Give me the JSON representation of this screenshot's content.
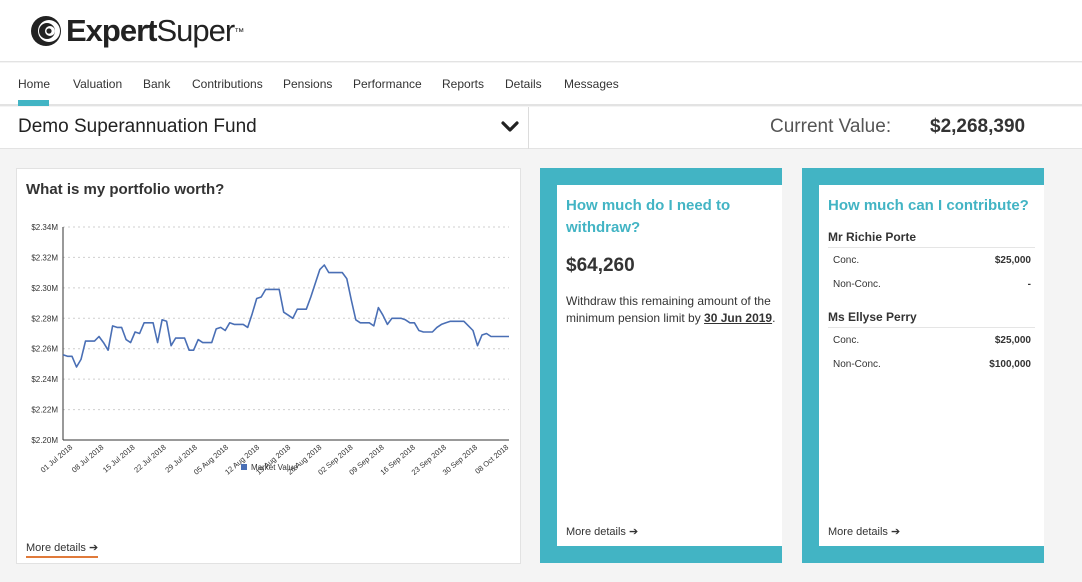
{
  "brand": {
    "name_part1": "Expert",
    "name_part2": "Super",
    "trademark": "™"
  },
  "nav": {
    "items": [
      {
        "label": "Home",
        "active": true
      },
      {
        "label": "Valuation"
      },
      {
        "label": "Bank"
      },
      {
        "label": "Contributions"
      },
      {
        "label": "Pensions"
      },
      {
        "label": "Performance"
      },
      {
        "label": "Reports"
      },
      {
        "label": "Details"
      },
      {
        "label": "Messages"
      }
    ]
  },
  "fund": {
    "name": "Demo Superannuation Fund",
    "current_value_label": "Current Value:",
    "current_value": "$2,268,390"
  },
  "portfolio_card": {
    "title": "What is my portfolio worth?",
    "more_details": "More details"
  },
  "chart_data": {
    "type": "line",
    "ylim": [
      2.2,
      2.34
    ],
    "y_ticks": [
      "$2.20M",
      "$2.22M",
      "$2.24M",
      "$2.26M",
      "$2.28M",
      "$2.30M",
      "$2.32M",
      "$2.34M"
    ],
    "x_ticks": [
      "01 Jul 2018",
      "08 Jul 2018",
      "15 Jul 2018",
      "22 Jul 2018",
      "29 Jul 2018",
      "05 Aug 2018",
      "12 Aug 2018",
      "19 Aug 2018",
      "26 Aug 2018",
      "02 Sep 2018",
      "09 Sep 2018",
      "16 Sep 2018",
      "23 Sep 2018",
      "30 Sep 2018",
      "08 Oct 2018"
    ],
    "grid": true,
    "legend_position": "bottom",
    "series": [
      {
        "name": "Market Value",
        "color": "#4a6fb5",
        "values": [
          2.256,
          2.255,
          2.255,
          2.248,
          2.253,
          2.265,
          2.265,
          2.265,
          2.268,
          2.264,
          2.259,
          2.275,
          2.274,
          2.274,
          2.266,
          2.264,
          2.271,
          2.27,
          2.277,
          2.277,
          2.277,
          2.264,
          2.279,
          2.278,
          2.262,
          2.267,
          2.267,
          2.267,
          2.259,
          2.259,
          2.266,
          2.264,
          2.264,
          2.264,
          2.273,
          2.274,
          2.272,
          2.277,
          2.276,
          2.276,
          2.276,
          2.274,
          2.283,
          2.293,
          2.294,
          2.299,
          2.299,
          2.299,
          2.299,
          2.284,
          2.282,
          2.28,
          2.286,
          2.286,
          2.286,
          2.294,
          2.303,
          2.312,
          2.315,
          2.31,
          2.31,
          2.31,
          2.31,
          2.306,
          2.292,
          2.279,
          2.277,
          2.277,
          2.277,
          2.275,
          2.287,
          2.282,
          2.276,
          2.28,
          2.28,
          2.28,
          2.279,
          2.277,
          2.277,
          2.272,
          2.271,
          2.271,
          2.271,
          2.274,
          2.276,
          2.277,
          2.278,
          2.278,
          2.278,
          2.278,
          2.275,
          2.272,
          2.262,
          2.269,
          2.27,
          2.268,
          2.268,
          2.268,
          2.268,
          2.268
        ]
      }
    ]
  },
  "withdraw_card": {
    "title": "How much do I need to withdraw?",
    "amount": "$64,260",
    "text_before": "Withdraw this remaining amount of the minimum pension limit by ",
    "date": "30 Jun 2019",
    "text_after": ".",
    "more_details": "More details"
  },
  "contribute_card": {
    "title": "How much can I contribute?",
    "members": [
      {
        "name": "Mr Richie Porte",
        "conc_label": "Conc.",
        "conc_value": "$25,000",
        "nonconc_label": "Non-Conc.",
        "nonconc_value": "-"
      },
      {
        "name": "Ms Ellyse Perry",
        "conc_label": "Conc.",
        "conc_value": "$25,000",
        "nonconc_label": "Non-Conc.",
        "nonconc_value": "$100,000"
      }
    ],
    "more_details": "More details"
  },
  "colors": {
    "accent": "#42b4c4",
    "line": "#4a6fb5",
    "link_underline": "#e07a3a"
  },
  "icons": {
    "chevron": "chevron-down-icon",
    "arrow": "arrow-right-icon"
  }
}
